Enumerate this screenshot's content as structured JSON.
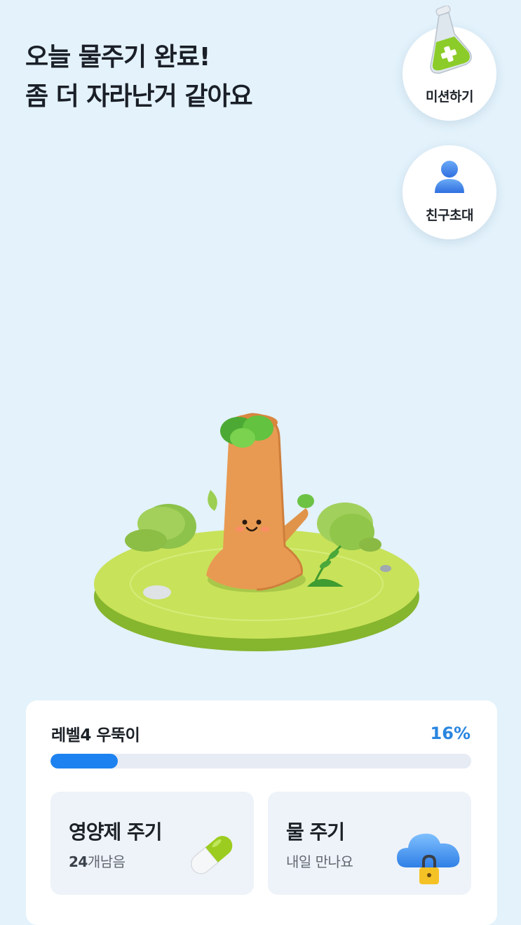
{
  "headline": {
    "line1": "오늘 물주기 완료!",
    "line2": "좀 더 자라난거 같아요"
  },
  "side_buttons": {
    "mission": {
      "label": "미션하기",
      "icon": "flask-plus-icon"
    },
    "invite": {
      "label": "친구초대",
      "icon": "person-icon"
    }
  },
  "status": {
    "level_label": "레벨4 우뚝이",
    "progress_text": "16%",
    "progress_fraction": 0.16
  },
  "cards": {
    "nutrient": {
      "title": "영양제 주기",
      "count": "24",
      "remaining_suffix": "개남음",
      "icon": "capsule-icon"
    },
    "water": {
      "title": "물 주기",
      "subtitle": "내일 만나요",
      "icon": "cloud-lock-icon"
    }
  },
  "colors": {
    "background": "#e3f2fb",
    "accent": "#1d82f0",
    "card_bg": "#eef3f9"
  }
}
